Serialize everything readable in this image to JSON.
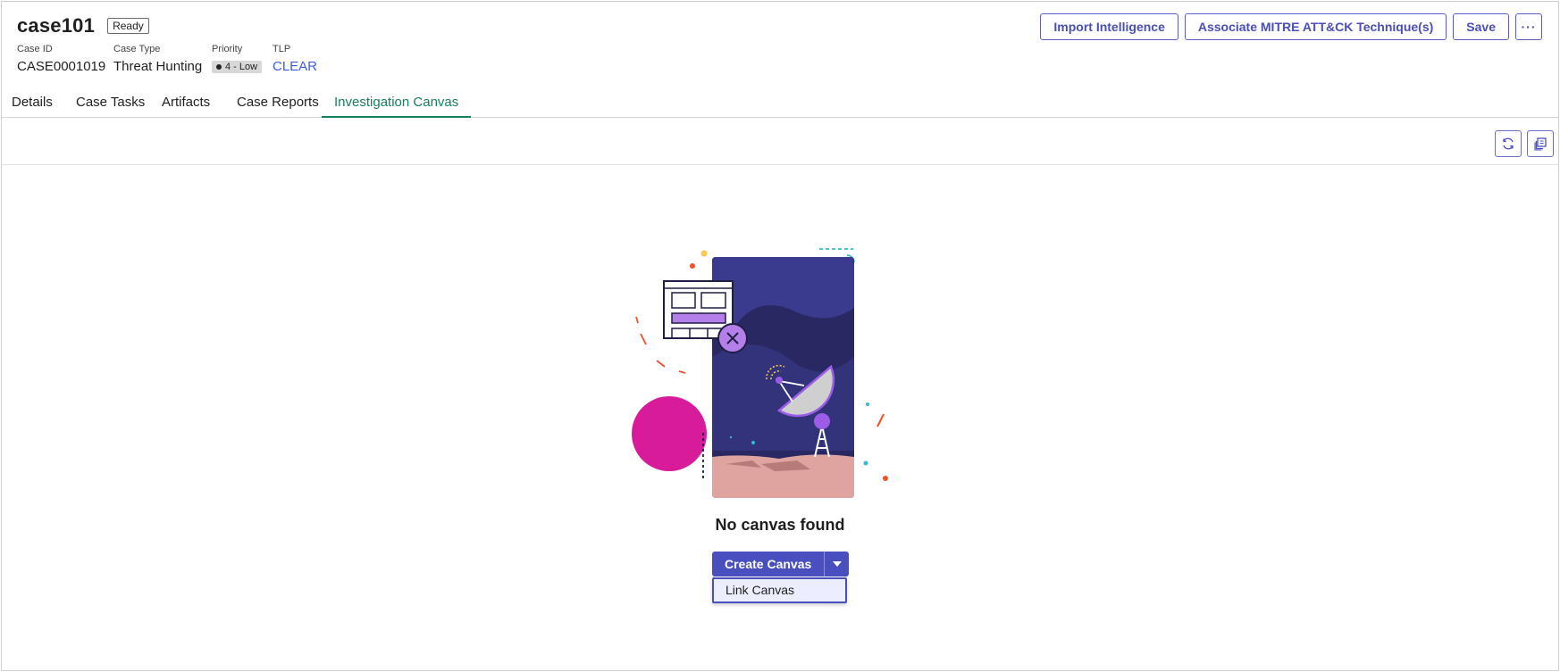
{
  "header": {
    "title": "case101",
    "state": "Ready",
    "case_id_label": "Case ID",
    "case_id": "CASE0001019",
    "case_type_label": "Case Type",
    "case_type": "Threat Hunting",
    "priority_label": "Priority",
    "priority": "4 - Low",
    "tlp_label": "TLP",
    "tlp": "CLEAR"
  },
  "actions": {
    "import": "Import Intelligence",
    "associate": "Associate MITRE ATT&CK Technique(s)",
    "save": "Save",
    "more": "···"
  },
  "tabs": [
    {
      "label": "Details"
    },
    {
      "label": "Case Tasks"
    },
    {
      "label": "Artifacts"
    },
    {
      "label": "Case Reports"
    },
    {
      "label": "Investigation Canvas"
    }
  ],
  "toolbar": {
    "refresh_icon": "refresh-icon",
    "copy_icon": "copy-icon"
  },
  "empty_state": {
    "title": "No canvas found",
    "create_label": "Create Canvas",
    "menu": [
      {
        "label": "Link Canvas"
      }
    ]
  },
  "colors": {
    "accent": "#4a4fc0",
    "active_tab": "#17805c",
    "link": "#3d5bd9"
  }
}
